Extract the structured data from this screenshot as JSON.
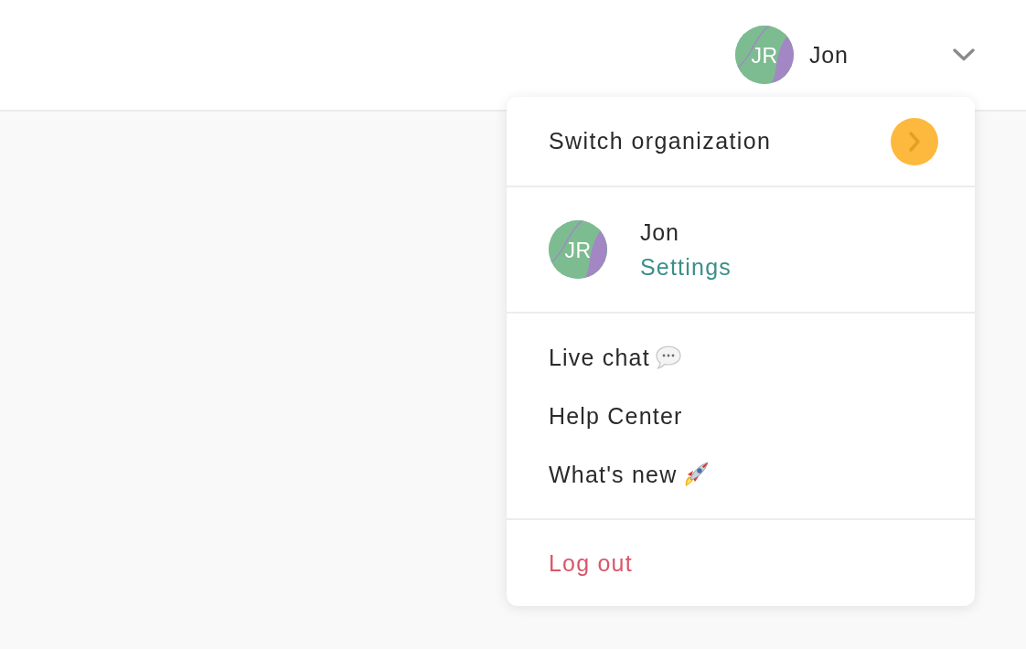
{
  "header": {
    "user": {
      "initials": "JR",
      "name": "Jon",
      "expanded": true
    }
  },
  "menu": {
    "switch_organization": {
      "label": "Switch organization"
    },
    "profile": {
      "initials": "JR",
      "name": "Jon",
      "settings_link": "Settings"
    },
    "links": [
      {
        "label": "Live chat",
        "kind": "chat"
      },
      {
        "label": "Help Center",
        "kind": "plain"
      },
      {
        "label": "What's new",
        "kind": "news"
      }
    ],
    "logout": {
      "label": "Log out"
    }
  }
}
